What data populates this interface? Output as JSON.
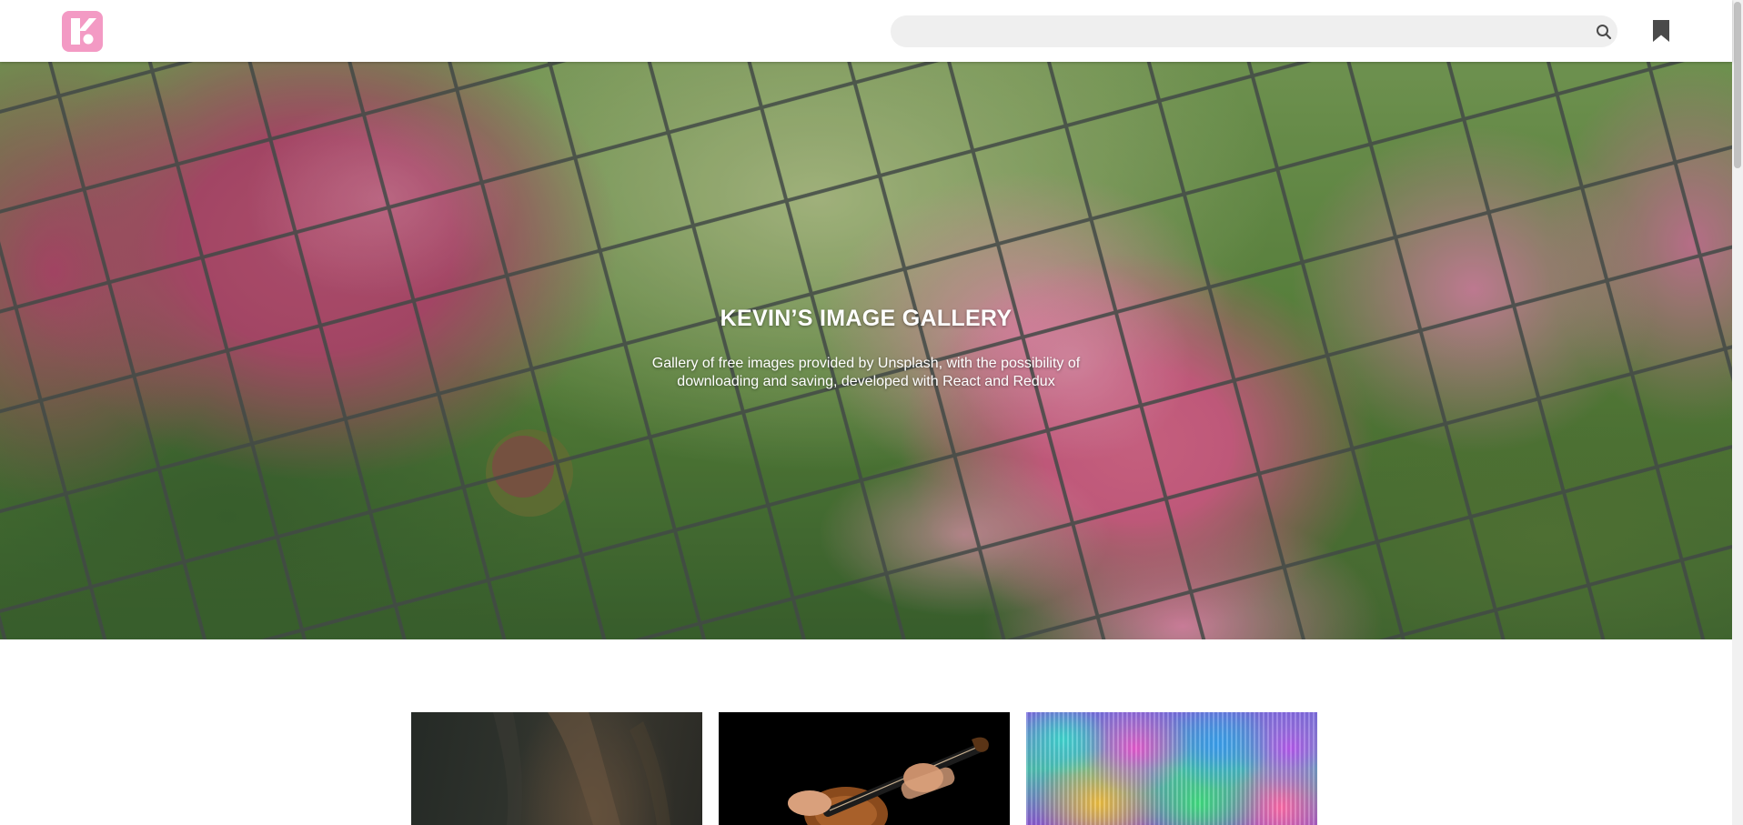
{
  "header": {
    "search": {
      "placeholder": "",
      "value": ""
    }
  },
  "hero": {
    "title": "KEVIN’S IMAGE GALLERY",
    "subtitle": "Gallery of free images provided by Unsplash, with the possibility of downloading and saving, developed with React and Redux"
  },
  "gallery": {
    "cards": [
      {
        "subject": "dark rock cliff"
      },
      {
        "subject": "violin player"
      },
      {
        "subject": "colorful abstract 3D"
      }
    ]
  },
  "icons": {
    "logo": "k-logo",
    "search": "search-icon",
    "bookmarks": "bookmark-icon"
  },
  "colors": {
    "brand": "#f39ac4",
    "search_bg": "#efefef",
    "icon": "#4a4a4a"
  }
}
